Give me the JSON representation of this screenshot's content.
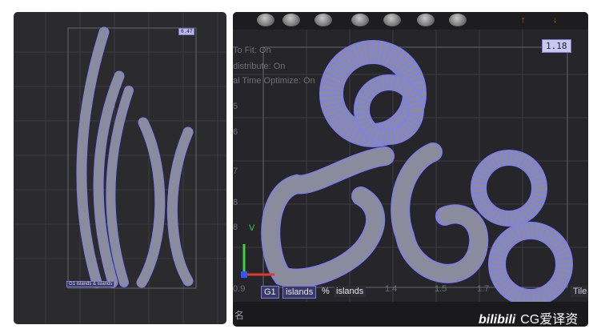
{
  "left_viewport": {
    "zoom_value": "0.47",
    "status_text": "G1 islands & islands"
  },
  "right_viewport": {
    "zoom_value": "1.18",
    "options": [
      "To Fit: On",
      "distribute: On",
      "al Time Optimize: On"
    ],
    "y_ticks": [
      "5",
      "6",
      "7",
      "8",
      "8"
    ],
    "x_ticks": [
      "0.9",
      "1.4",
      "1.5",
      "1.7"
    ],
    "group_tab": "G1",
    "islands_tab": "islands",
    "percent_tab": "%",
    "islands_tab_2": "islands",
    "tile_tab": "Tile",
    "axis_v": "V",
    "bottom_fragment": "名"
  },
  "watermark": {
    "brand": "bilibili",
    "text": "CG爱译资"
  },
  "colors": {
    "island_fill": "#8a8b9c",
    "island_edge": "#7e7ff0",
    "grid": "#3d3d42",
    "panel_bg": "#2b2b2e"
  }
}
